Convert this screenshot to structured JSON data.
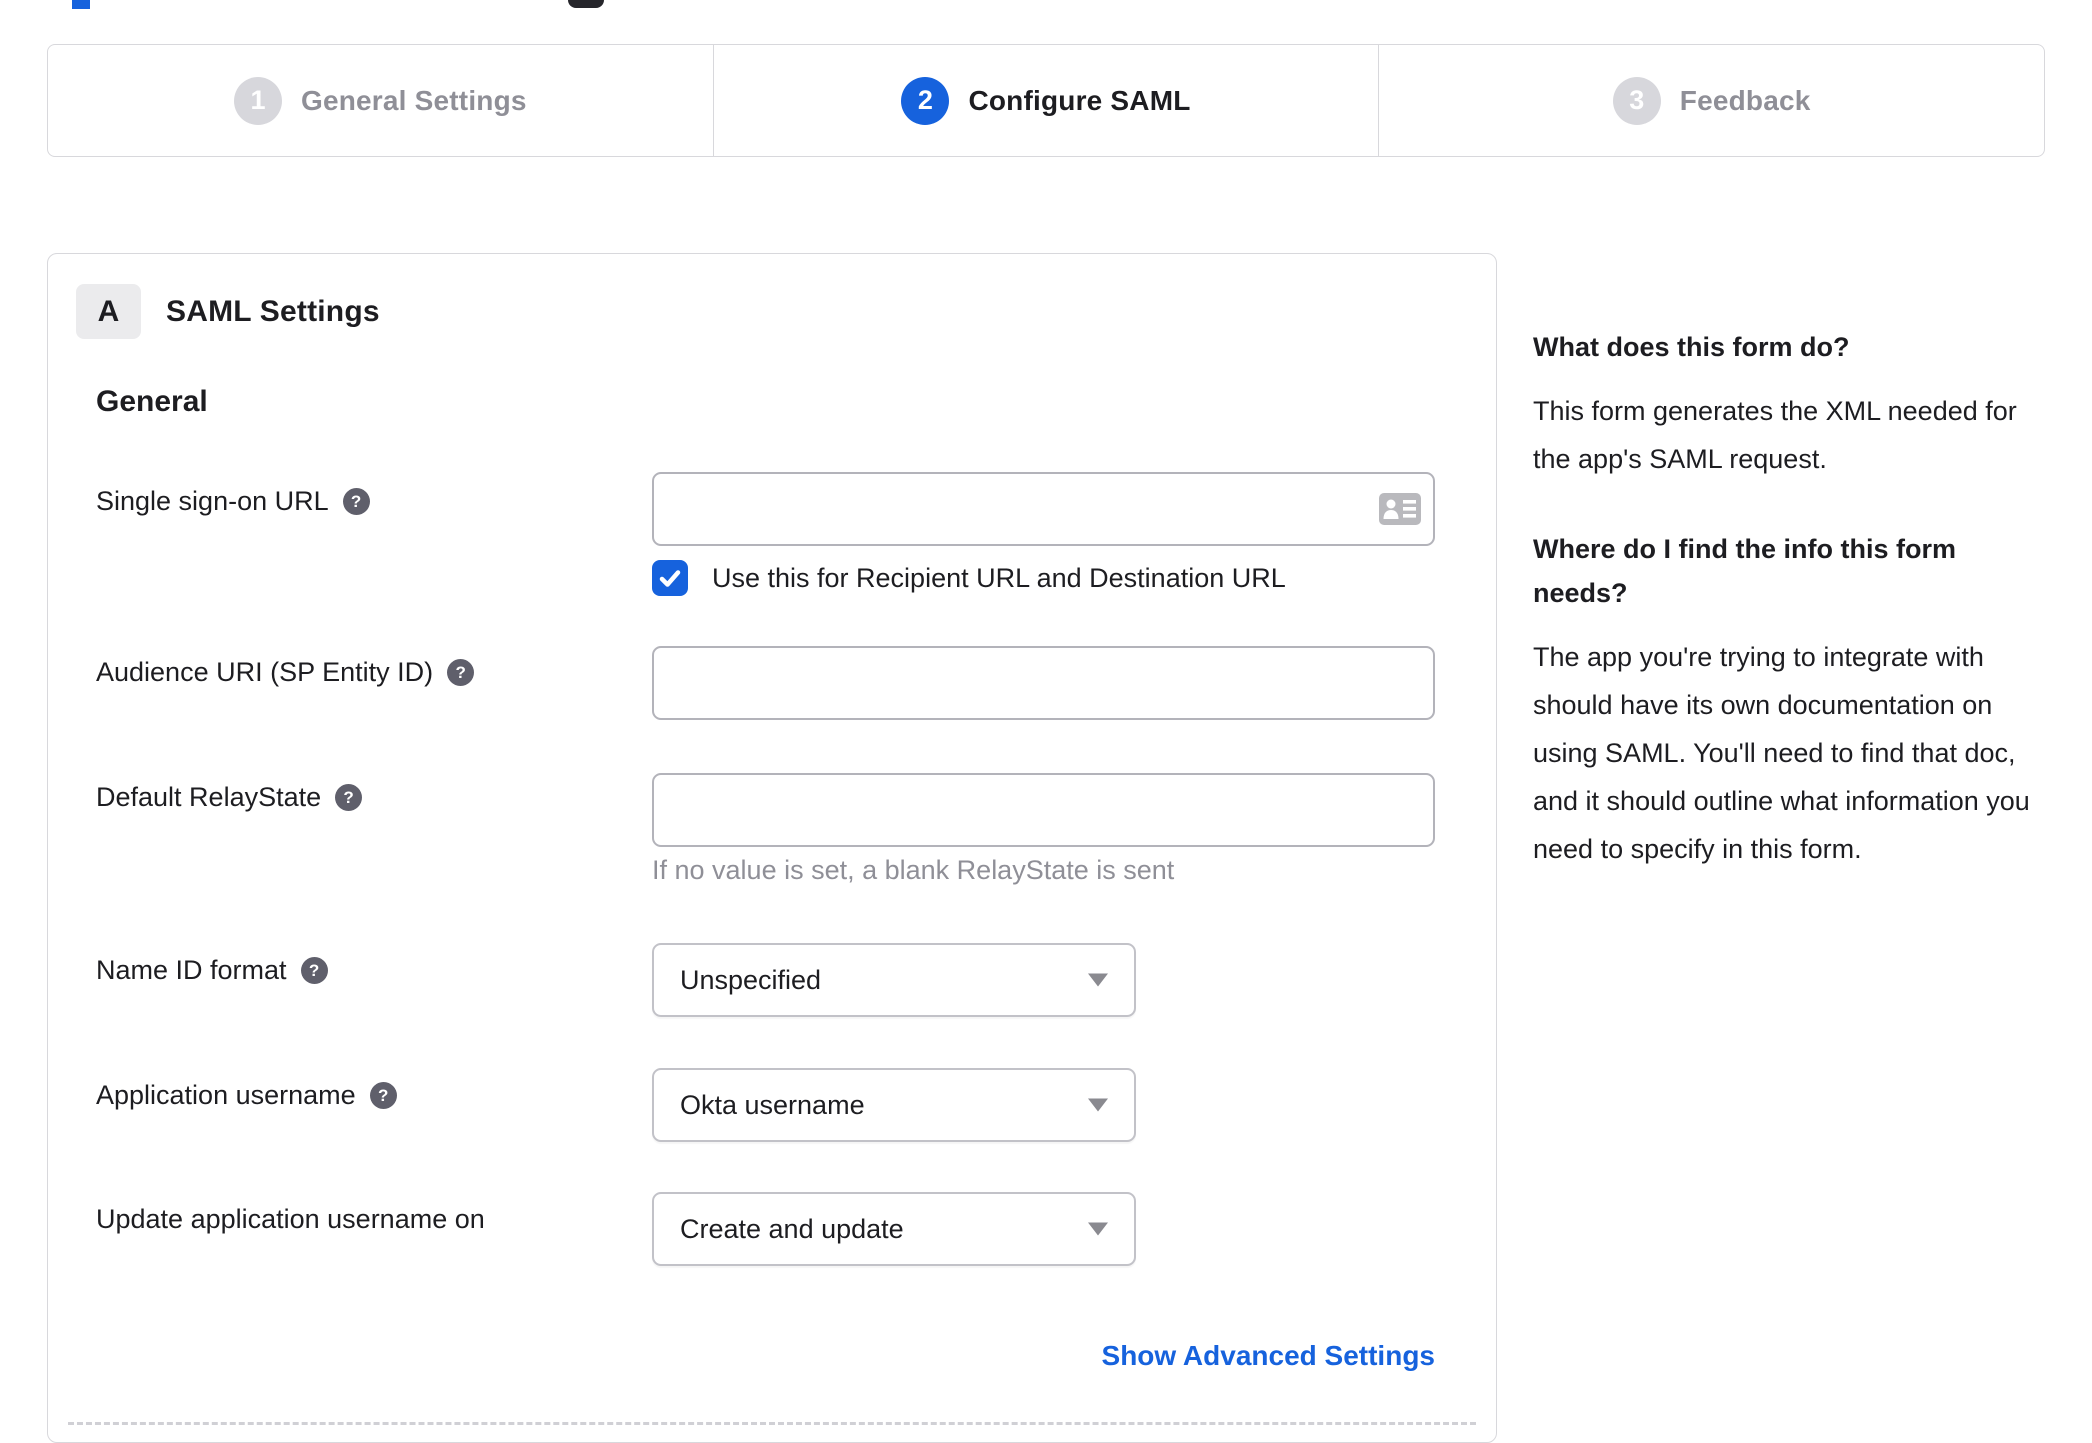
{
  "colors": {
    "accent_blue": "#1662dd",
    "text_dark": "#1d1d21",
    "text_muted": "#8f8f97",
    "border": "#d8d8dc",
    "inactive_step": "#d7d7dc"
  },
  "icons": {
    "help": "question-mark-circle-icon",
    "sso_input": "contact-card-icon",
    "select": "caret-down-icon",
    "checkbox": "checkmark-icon"
  },
  "stepper": {
    "steps": [
      {
        "number": "1",
        "label": "General Settings",
        "state": "inactive"
      },
      {
        "number": "2",
        "label": "Configure SAML",
        "state": "active"
      },
      {
        "number": "3",
        "label": "Feedback",
        "state": "inactive"
      }
    ]
  },
  "panel": {
    "badge": "A",
    "title": "SAML Settings",
    "section_heading": "General",
    "fields": {
      "sso": {
        "label": "Single sign-on URL",
        "value": "",
        "checkbox_label": "Use this for Recipient URL and Destination URL",
        "checkbox_checked": true
      },
      "audience": {
        "label": "Audience URI (SP Entity ID)",
        "value": ""
      },
      "relay": {
        "label": "Default RelayState",
        "value": "",
        "hint": "If no value is set, a blank RelayState is sent"
      },
      "name_id": {
        "label": "Name ID format",
        "value": "Unspecified"
      },
      "app_username": {
        "label": "Application username",
        "value": "Okta username"
      },
      "update_username": {
        "label": "Update application username on",
        "value": "Create and update"
      }
    },
    "advanced_link": "Show Advanced Settings"
  },
  "sidebar": {
    "q1": "What does this form do?",
    "a1": "This form generates the XML needed for the app's SAML request.",
    "q2": "Where do I find the info this form needs?",
    "a2": "The app you're trying to integrate with should have its own documentation on using SAML. You'll need to find that doc, and it should outline what information you need to specify in this form."
  }
}
